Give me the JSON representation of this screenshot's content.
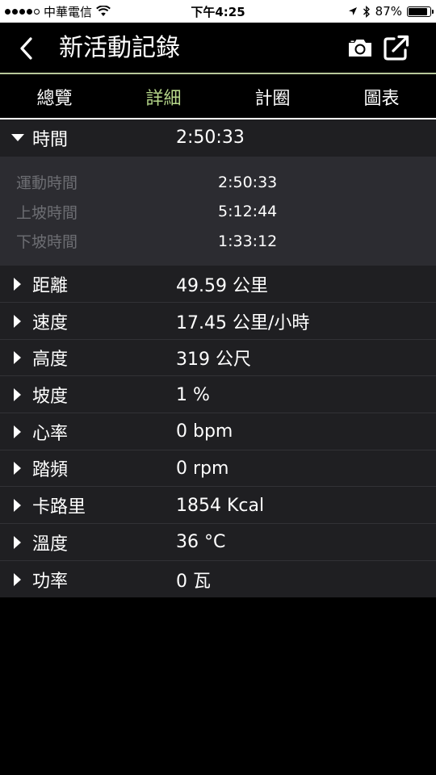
{
  "status_bar": {
    "carrier": "中華電信",
    "time": "下午4:25",
    "battery": "87%",
    "battery_level": 0.87,
    "icons": [
      "signal-dots-icon",
      "wifi-icon",
      "location-arrow-icon",
      "bluetooth-icon",
      "battery-icon"
    ]
  },
  "header": {
    "title": "新活動記錄",
    "icons": [
      "back-chevron-icon",
      "camera-icon",
      "share-external-icon"
    ]
  },
  "tabs": [
    {
      "label": "總覽",
      "active": false
    },
    {
      "label": "詳細",
      "active": true
    },
    {
      "label": "計圈",
      "active": false
    },
    {
      "label": "圖表",
      "active": false
    }
  ],
  "time_section": {
    "label": "時間",
    "value": "2:50:33",
    "details": [
      {
        "label": "運動時間",
        "value": "2:50:33"
      },
      {
        "label": "上坡時間",
        "value": "5:12:44"
      },
      {
        "label": "下坡時間",
        "value": "1:33:12"
      }
    ]
  },
  "stats": [
    {
      "label": "距離",
      "value": "49.59 公里"
    },
    {
      "label": "速度",
      "value": "17.45 公里/小時"
    },
    {
      "label": "高度",
      "value": "319 公尺"
    },
    {
      "label": "坡度",
      "value": "1 %"
    },
    {
      "label": "心率",
      "value": "0 bpm"
    },
    {
      "label": "踏頻",
      "value": "0 rpm"
    },
    {
      "label": "卡路里",
      "value": "1854 Kcal"
    },
    {
      "label": "溫度",
      "value": "36 °C"
    },
    {
      "label": "功率",
      "value": "0 瓦"
    }
  ],
  "colors": {
    "accent": "#b6d78a",
    "header_line": "#b7c79a",
    "row_bg": "#1f1f22",
    "detail_bg": "#2c2c31",
    "detail_label": "#6d6e73"
  }
}
